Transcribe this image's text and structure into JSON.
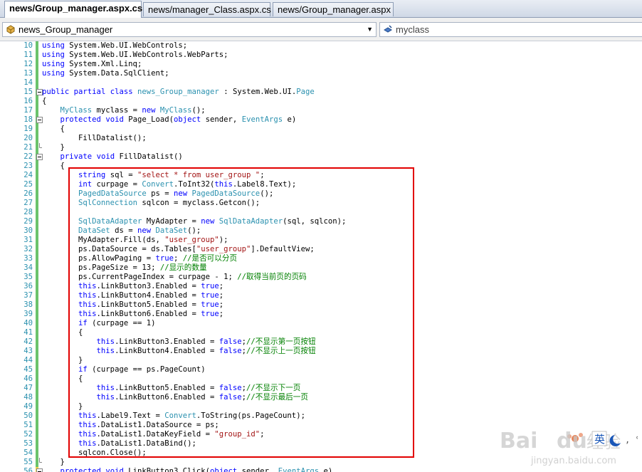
{
  "tabs": [
    {
      "label": "news/Group_manager.aspx.cs",
      "active": true
    },
    {
      "label": "news/manager_Class.aspx.cs",
      "active": false
    },
    {
      "label": "news/Group_manager.aspx",
      "active": false
    }
  ],
  "nav": {
    "class_combo": "news_Group_manager",
    "member_combo": "myclass",
    "member_icon": "field-icon",
    "class_icon": "class-icon"
  },
  "colors": {
    "keyword": "#0000ff",
    "type": "#2b91af",
    "string": "#a31515",
    "comment": "#008000",
    "highlight_box": "#e20000",
    "line_number": "#2b91af",
    "change_bar": "#6cc36c"
  },
  "code_lines": [
    {
      "n": "10",
      "t": "using System.Web.UI.WebControls;"
    },
    {
      "n": "11",
      "t": "using System.Web.UI.WebControls.WebParts;"
    },
    {
      "n": "12",
      "t": "using System.Xml.Linq;"
    },
    {
      "n": "13",
      "t": "using System.Data.SqlClient;"
    },
    {
      "n": "14",
      "t": ""
    },
    {
      "n": "15",
      "t": "public partial class news_Group_manager : System.Web.UI.Page"
    },
    {
      "n": "16",
      "t": "{"
    },
    {
      "n": "17",
      "t": "    MyClass myclass = new MyClass();"
    },
    {
      "n": "18",
      "t": "    protected void Page_Load(object sender, EventArgs e)"
    },
    {
      "n": "19",
      "t": "    {"
    },
    {
      "n": "20",
      "t": "        FillDatalist();"
    },
    {
      "n": "21",
      "t": "    }"
    },
    {
      "n": "22",
      "t": "    private void FillDatalist()"
    },
    {
      "n": "23",
      "t": "    {"
    },
    {
      "n": "24",
      "t": "        string sql = \"select * from user_group \";"
    },
    {
      "n": "25",
      "t": "        int curpage = Convert.ToInt32(this.Label8.Text);"
    },
    {
      "n": "26",
      "t": "        PagedDataSource ps = new PagedDataSource();"
    },
    {
      "n": "27",
      "t": "        SqlConnection sqlcon = myclass.Getcon();"
    },
    {
      "n": "28",
      "t": ""
    },
    {
      "n": "29",
      "t": "        SqlDataAdapter MyAdapter = new SqlDataAdapter(sql, sqlcon);"
    },
    {
      "n": "30",
      "t": "        DataSet ds = new DataSet();"
    },
    {
      "n": "31",
      "t": "        MyAdapter.Fill(ds, \"user_group\");"
    },
    {
      "n": "32",
      "t": "        ps.DataSource = ds.Tables[\"user_group\"].DefaultView;"
    },
    {
      "n": "33",
      "t": "        ps.AllowPaging = true; //是否可以分页"
    },
    {
      "n": "34",
      "t": "        ps.PageSize = 13; //显示的数量"
    },
    {
      "n": "35",
      "t": "        ps.CurrentPageIndex = curpage - 1; //取得当前页的页码"
    },
    {
      "n": "36",
      "t": "        this.LinkButton3.Enabled = true;"
    },
    {
      "n": "37",
      "t": "        this.LinkButton4.Enabled = true;"
    },
    {
      "n": "38",
      "t": "        this.LinkButton5.Enabled = true;"
    },
    {
      "n": "39",
      "t": "        this.LinkButton6.Enabled = true;"
    },
    {
      "n": "40",
      "t": "        if (curpage == 1)"
    },
    {
      "n": "41",
      "t": "        {"
    },
    {
      "n": "42",
      "t": "            this.LinkButton3.Enabled = false;//不显示第一页按钮"
    },
    {
      "n": "43",
      "t": "            this.LinkButton4.Enabled = false;//不显示上一页按钮"
    },
    {
      "n": "44",
      "t": "        }"
    },
    {
      "n": "45",
      "t": "        if (curpage == ps.PageCount)"
    },
    {
      "n": "46",
      "t": "        {"
    },
    {
      "n": "47",
      "t": "            this.LinkButton5.Enabled = false;//不显示下一页"
    },
    {
      "n": "48",
      "t": "            this.LinkButton6.Enabled = false;//不显示最后一页"
    },
    {
      "n": "49",
      "t": "        }"
    },
    {
      "n": "50",
      "t": "        this.Label9.Text = Convert.ToString(ps.PageCount);"
    },
    {
      "n": "51",
      "t": "        this.DataList1.DataSource = ps;"
    },
    {
      "n": "52",
      "t": "        this.DataList1.DataKeyField = \"group_id\";"
    },
    {
      "n": "53",
      "t": "        this.DataList1.DataBind();"
    },
    {
      "n": "54",
      "t": "        sqlcon.Close();"
    },
    {
      "n": "55",
      "t": "    }"
    },
    {
      "n": "56",
      "t": "    protected void LinkButton3_Click(object sender, EventArgs e)"
    }
  ],
  "watermark": {
    "brand": "Bai du 经验",
    "url": "jingyan.baidu.com",
    "ime": "英"
  }
}
